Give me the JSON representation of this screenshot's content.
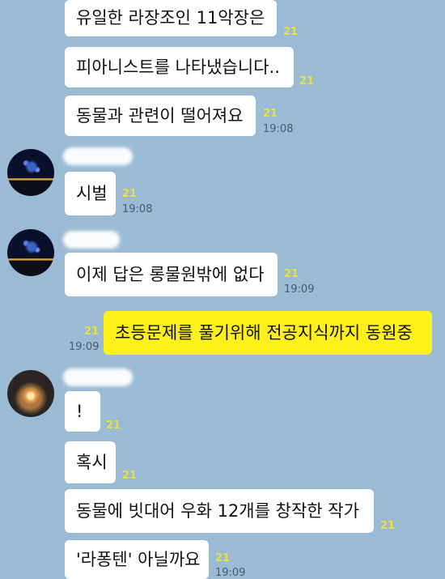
{
  "messages": [
    {
      "text": "유일한 라장조인 11악장은",
      "unread": "21"
    },
    {
      "text": "피아니스트를 나타냈습니다..",
      "unread": "21"
    },
    {
      "text": "동물과 관련이 떨어져요",
      "unread": "21",
      "time": "19:08"
    },
    {
      "text": "시벌",
      "unread": "21",
      "time": "19:08"
    },
    {
      "text": "이제 답은 롱물원밖에 없다",
      "unread": "21",
      "time": "19:09"
    },
    {
      "text": "초등문제를 풀기위해 전공지식까지 동원중",
      "unread": "21",
      "time": "19:09"
    },
    {
      "text": "!",
      "unread": "21"
    },
    {
      "text": "혹시",
      "unread": "21"
    },
    {
      "text": "동물에 빗대어 우화 12개를 창작한 작가",
      "unread": "21"
    },
    {
      "text": "'라퐁텐' 아닐까요",
      "unread": "21",
      "time": "19:09"
    }
  ],
  "colors": {
    "background": "#9bbbd4",
    "my_bubble": "#fef01b",
    "other_bubble": "#ffffff",
    "unread_count": "#e9e23a"
  },
  "icons": [
    "profile-avatar-night-city",
    "profile-avatar-candle"
  ]
}
